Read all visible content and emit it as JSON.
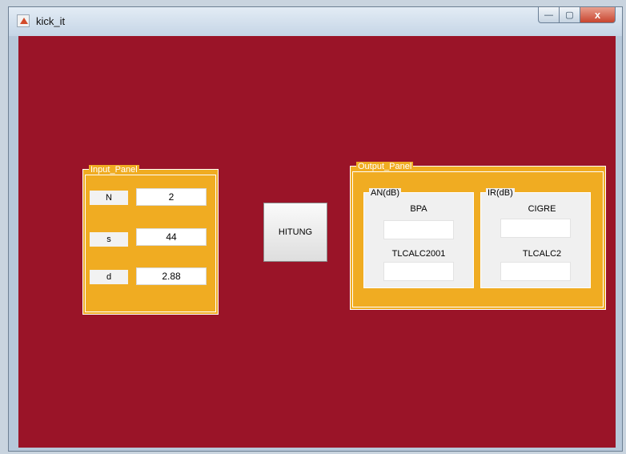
{
  "window": {
    "title": "kick_it",
    "controls": {
      "minimize": "—",
      "maximize": "▢",
      "close": "x"
    }
  },
  "input_panel": {
    "title": "Input_Panel",
    "rows": [
      {
        "label": "N",
        "value": "2"
      },
      {
        "label": "s",
        "value": "44"
      },
      {
        "label": "d",
        "value": "2.88"
      }
    ]
  },
  "hitung_button": {
    "label": "HITUNG"
  },
  "output_panel": {
    "title": "Output_Panel",
    "an": {
      "title": "AN(dB)",
      "label1": "BPA",
      "value1": "",
      "label2": "TLCALC2001",
      "value2": ""
    },
    "ir": {
      "title": "IR(dB)",
      "label1": "CIGRE",
      "value1": "",
      "label2": "TLCALC2",
      "value2": ""
    }
  },
  "colors": {
    "background": "#9a1428",
    "panel": "#f0ac22"
  }
}
